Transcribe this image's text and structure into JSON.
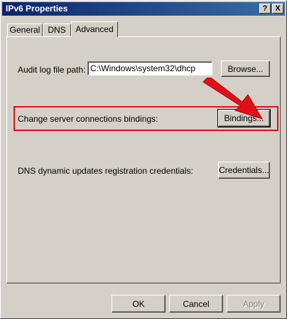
{
  "window": {
    "title": "IPv6 Properties",
    "help_label": "?",
    "close_label": "X"
  },
  "tabs": [
    {
      "label": "General",
      "active": false
    },
    {
      "label": "DNS",
      "active": false
    },
    {
      "label": "Advanced",
      "active": true
    }
  ],
  "advanced": {
    "audit_log_label": "Audit log file path:",
    "audit_log_value": "C:\\Windows\\system32\\dhcp",
    "browse_label": "Browse...",
    "bindings_text": "Change server connections bindings:",
    "bindings_button_label": "Bindings...",
    "credentials_text": "DNS dynamic updates registration credentials:",
    "credentials_button_label": "Credentials..."
  },
  "footer": {
    "ok_label": "OK",
    "cancel_label": "Cancel",
    "apply_label": "Apply"
  },
  "colors": {
    "annotation": "#e0101a",
    "title_bar": "#0a246a",
    "face": "#d4d0c8"
  }
}
